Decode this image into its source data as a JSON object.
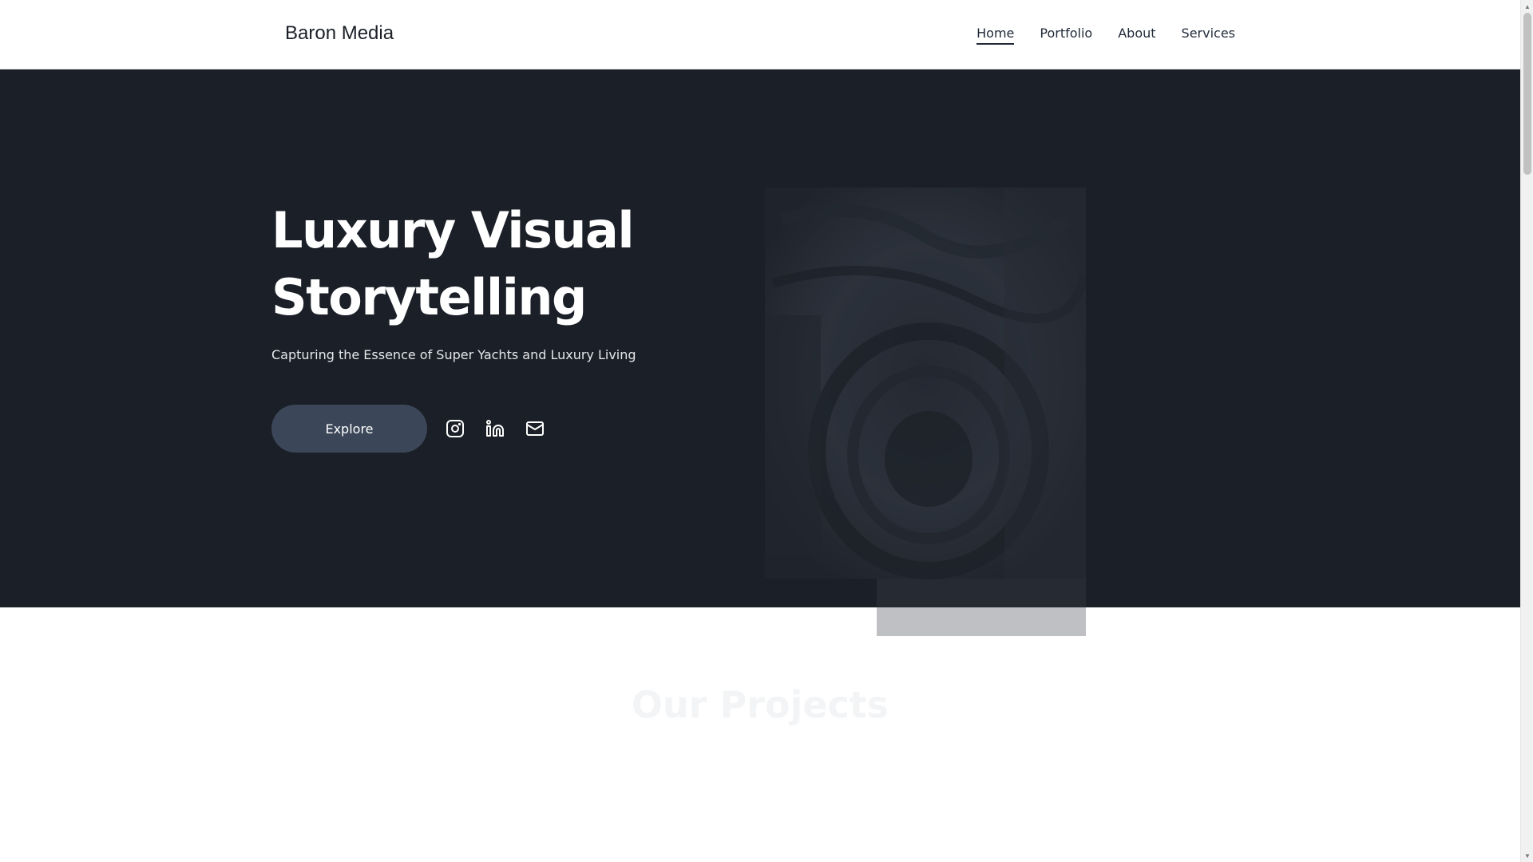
{
  "header": {
    "brand": "Baron Media",
    "nav": [
      {
        "label": "Home",
        "active": true
      },
      {
        "label": "Portfolio",
        "active": false
      },
      {
        "label": "About",
        "active": false
      },
      {
        "label": "Services",
        "active": false
      }
    ]
  },
  "hero": {
    "title_line1": "Luxury Visual",
    "title_line2": "Storytelling",
    "subtitle": "Capturing the Essence of Super Yachts and Luxury Living",
    "cta_label": "Explore",
    "social_icons": [
      "instagram-icon",
      "linkedin-icon",
      "mail-icon"
    ]
  },
  "projects": {
    "title": "Our Projects"
  },
  "colors": {
    "hero_bg": "#1b1f27",
    "button_bg": "#3b4758",
    "text_dark": "#1f2937"
  }
}
